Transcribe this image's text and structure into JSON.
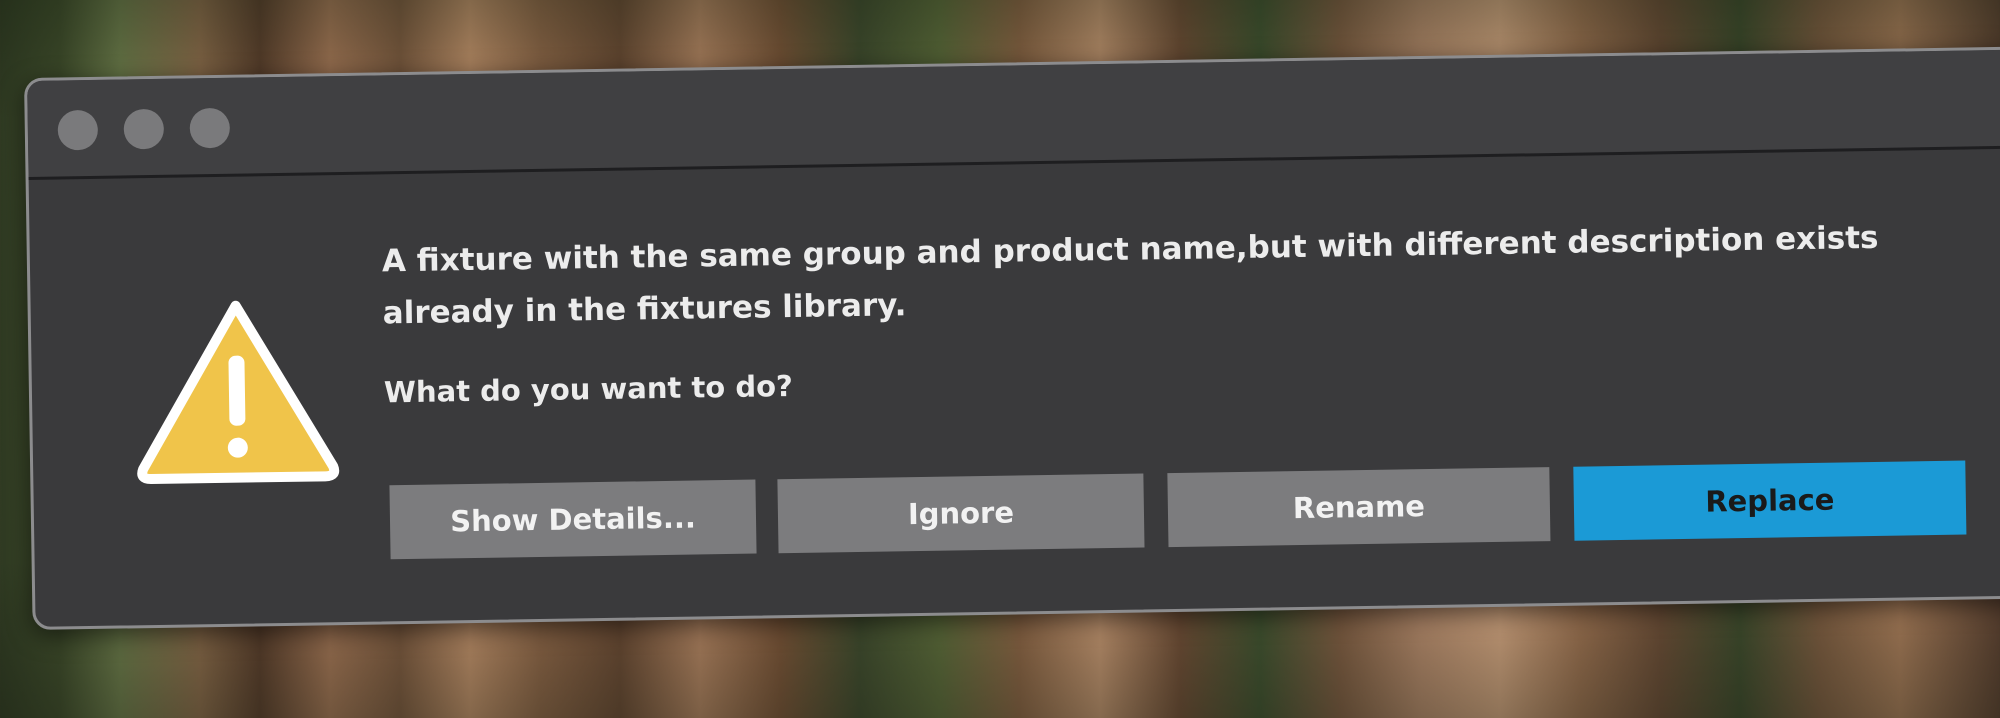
{
  "window": {
    "controls": [
      "close",
      "minimize",
      "zoom"
    ]
  },
  "alert": {
    "icon": "warning-triangle-icon",
    "icon_color": "#f0c44a",
    "message": "A fixture with the same group and product name,but with different description exists already in the fixtures library.",
    "question": "What do you want to do?"
  },
  "buttons": {
    "show_details": "Show Details...",
    "ignore": "Ignore",
    "rename": "Rename",
    "replace": "Replace"
  },
  "colors": {
    "dialog_background": "#3a3a3c",
    "default_button": "#1b9ad6",
    "secondary_button": "#7c7c7e"
  }
}
